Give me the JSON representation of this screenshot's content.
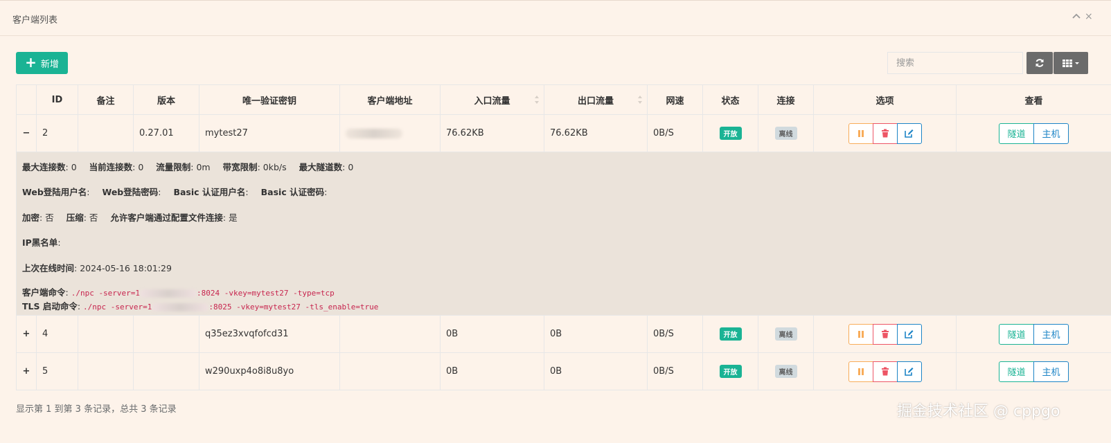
{
  "panel": {
    "title": "客户端列表"
  },
  "toolbar": {
    "add_label": "新增",
    "search_placeholder": "搜索"
  },
  "table": {
    "columns": [
      "ID",
      "备注",
      "版本",
      "唯一验证密钥",
      "客户端地址",
      "入口流量",
      "出口流量",
      "网速",
      "状态",
      "连接",
      "选项",
      "查看"
    ],
    "rows": [
      {
        "expander": "−",
        "id": "2",
        "remark": "",
        "version": "0.27.01",
        "vkey": "mytest27",
        "addr": "",
        "in": "76.62KB",
        "out": "76.62KB",
        "speed": "0B/S",
        "status": "开放",
        "conn": "离线",
        "tunnel": "隧道",
        "host": "主机"
      },
      {
        "expander": "+",
        "id": "4",
        "remark": "",
        "version": "",
        "vkey": "q35ez3xvqfofcd31",
        "addr": "",
        "in": "0B",
        "out": "0B",
        "speed": "0B/S",
        "status": "开放",
        "conn": "离线",
        "tunnel": "隧道",
        "host": "主机"
      },
      {
        "expander": "+",
        "id": "5",
        "remark": "",
        "version": "",
        "vkey": "w290uxp4o8i8u8yo",
        "addr": "",
        "in": "0B",
        "out": "0B",
        "speed": "0B/S",
        "status": "开放",
        "conn": "离线",
        "tunnel": "隧道",
        "host": "主机"
      }
    ]
  },
  "detail": {
    "max_conn_label": "最大连接数",
    "max_conn": ": 0",
    "cur_conn_label": "当前连接数",
    "cur_conn": ": 0",
    "flow_limit_label": "流量限制",
    "flow_limit": ": 0m",
    "rate_limit_label": "带宽限制",
    "rate_limit": ": 0kb/s",
    "max_tunnel_label": "最大隧道数",
    "max_tunnel": ": 0",
    "web_user_label": "Web登陆用户名",
    "web_user": ":",
    "web_pass_label": "Web登陆密码",
    "web_pass": ":",
    "basic_user_label": "Basic 认证用户名",
    "basic_user": ":",
    "basic_pass_label": "Basic 认证密码",
    "basic_pass": ":",
    "crypt_label": "加密",
    "crypt": ": 否",
    "compress_label": "压缩",
    "compress": ": 否",
    "config_conn_label": "允许客户端通过配置文件连接",
    "config_conn": ": 是",
    "blacklist_label": "IP黑名单",
    "blacklist": ":",
    "last_online_label": "上次在线时间",
    "last_online": ": 2024-05-16 18:01:29",
    "cmd_label": "客户端命令",
    "cmd_prefix": "./npc -server=1",
    "cmd_suffix": ":8024 -vkey=mytest27 -type=tcp",
    "tls_label": "TLS 启动命令",
    "tls_prefix": "./npc -server=1",
    "tls_suffix": ":8025 -vkey=mytest27 -tls_enable=true"
  },
  "footer": {
    "summary": "显示第 1 到第 3 条记录，总共 3 条记录"
  },
  "watermark": "掘金技术社区 @ cppgo",
  "colors": {
    "primary": "#1ab394",
    "danger": "#ed5565",
    "warning": "#f8ac59",
    "info": "#1c84c6"
  },
  "icons": [
    "plus-icon",
    "refresh-icon",
    "columns-icon",
    "pause-icon",
    "trash-icon",
    "edit-icon",
    "sort-icon",
    "chevron-up-icon"
  ]
}
